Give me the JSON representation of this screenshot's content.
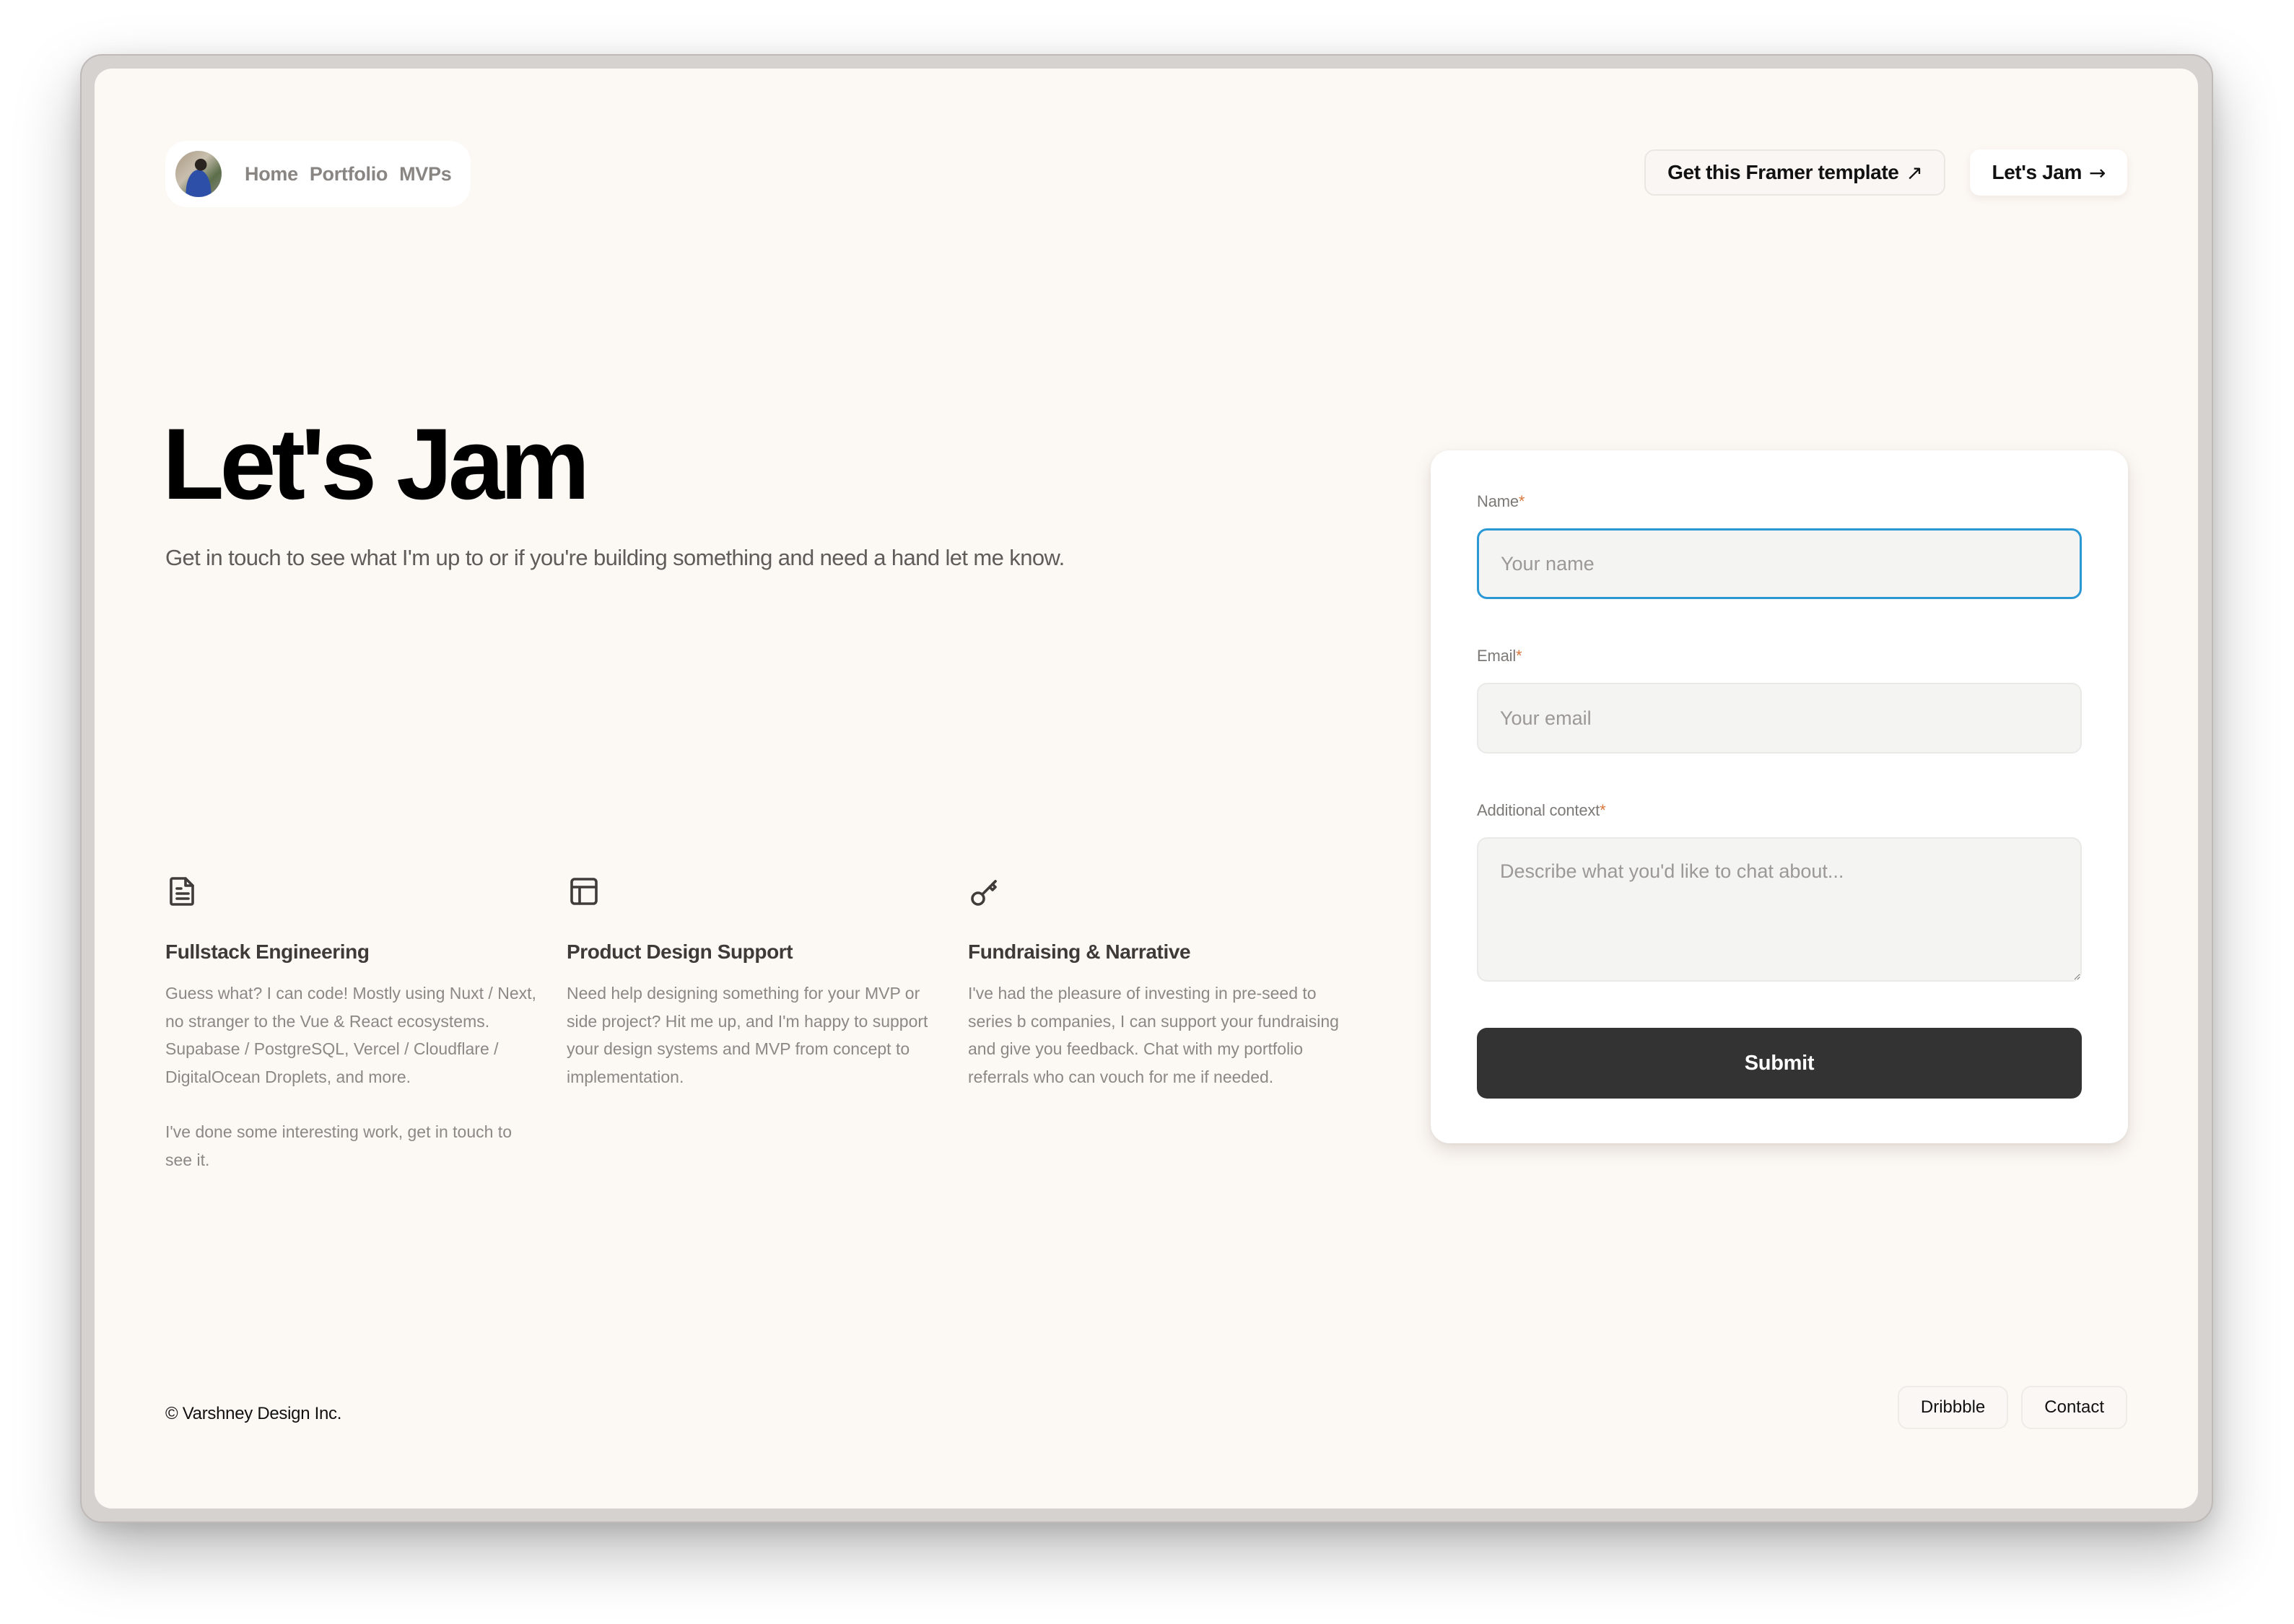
{
  "nav": {
    "avatar_alt": "profile photo",
    "links": [
      {
        "label": "Home"
      },
      {
        "label": "Portfolio"
      },
      {
        "label": "MVPs"
      }
    ]
  },
  "header_actions": {
    "template_button": {
      "label": "Get this Framer template",
      "icon": "arrow-up-right-icon",
      "glyph": "↗"
    },
    "jam_button": {
      "label": "Let's Jam",
      "icon": "arrow-right-icon",
      "glyph": "→"
    }
  },
  "hero": {
    "title": "Let's Jam",
    "subtitle": "Get in touch to see what I'm up to or if you're building something and need a hand let me know."
  },
  "services": [
    {
      "icon": "document-icon",
      "title": "Fullstack Engineering",
      "paragraphs": [
        "Guess what? I can code! Mostly using Nuxt / Next, no stranger to the Vue & React ecosystems. Supabase / PostgreSQL, Vercel / Cloudflare / DigitalOcean Droplets, and more.",
        "I've done some interesting work, get in touch to see it."
      ]
    },
    {
      "icon": "layout-icon",
      "title": "Product Design Support",
      "paragraphs": [
        "Need help designing something for your MVP or side project? Hit me up, and I'm happy to support your design systems and MVP from concept to implementation."
      ]
    },
    {
      "icon": "key-icon",
      "title": "Fundraising & Narrative",
      "paragraphs": [
        "I've had the pleasure of investing in pre-seed to series b companies, I can support your fundraising and give you feedback. Chat with my portfolio referrals who can vouch for me if needed."
      ]
    }
  ],
  "form": {
    "fields": [
      {
        "label": "Name",
        "required_mark": "*",
        "placeholder": "Your name",
        "value": "",
        "focused": true
      },
      {
        "label": "Email",
        "required_mark": "*",
        "placeholder": "Your email",
        "value": ""
      },
      {
        "label": "Additional context",
        "required_mark": "*",
        "placeholder": "Describe what you'd like to chat about...",
        "value": ""
      }
    ],
    "submit_label": "Submit"
  },
  "footer": {
    "copyright": "© Varshney Design Inc.",
    "links": [
      {
        "label": "Dribbble"
      },
      {
        "label": "Contact"
      }
    ]
  },
  "colors": {
    "page_bg": "#fcf8f4",
    "accent_focus": "#2b98d6",
    "required_mark": "#d9773d",
    "submit_bg": "#333333"
  }
}
